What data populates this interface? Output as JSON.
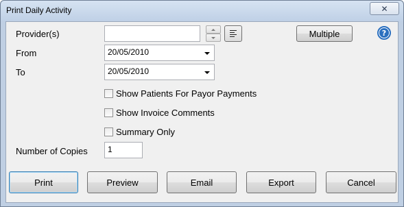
{
  "window": {
    "title": "Print Daily Activity",
    "close_glyph": "✕"
  },
  "form": {
    "providers_label": "Provider(s)",
    "providers_value": "",
    "multiple_label": "Multiple",
    "from_label": "From",
    "from_value": "20/05/2010",
    "to_label": "To",
    "to_value": "20/05/2010",
    "checkboxes": [
      {
        "label": "Show Patients For Payor Payments",
        "checked": false
      },
      {
        "label": "Show Invoice Comments",
        "checked": false
      },
      {
        "label": "Summary Only",
        "checked": false
      }
    ],
    "copies_label": "Number of Copies",
    "copies_value": "1",
    "help_glyph": "?"
  },
  "buttons": {
    "print": "Print",
    "preview": "Preview",
    "email": "Email",
    "export": "Export",
    "cancel": "Cancel"
  },
  "icons": {
    "list": "list-lines-icon",
    "help": "help-icon",
    "close": "close-icon",
    "dropdown": "chevron-down-icon",
    "spin_up": "spin-up-icon",
    "spin_down": "spin-down-icon"
  },
  "colors": {
    "frame": "#bfcfe3",
    "client": "#f0f0f0",
    "help_blue": "#2a6fbf",
    "default_button_border": "#3c7fb1"
  }
}
